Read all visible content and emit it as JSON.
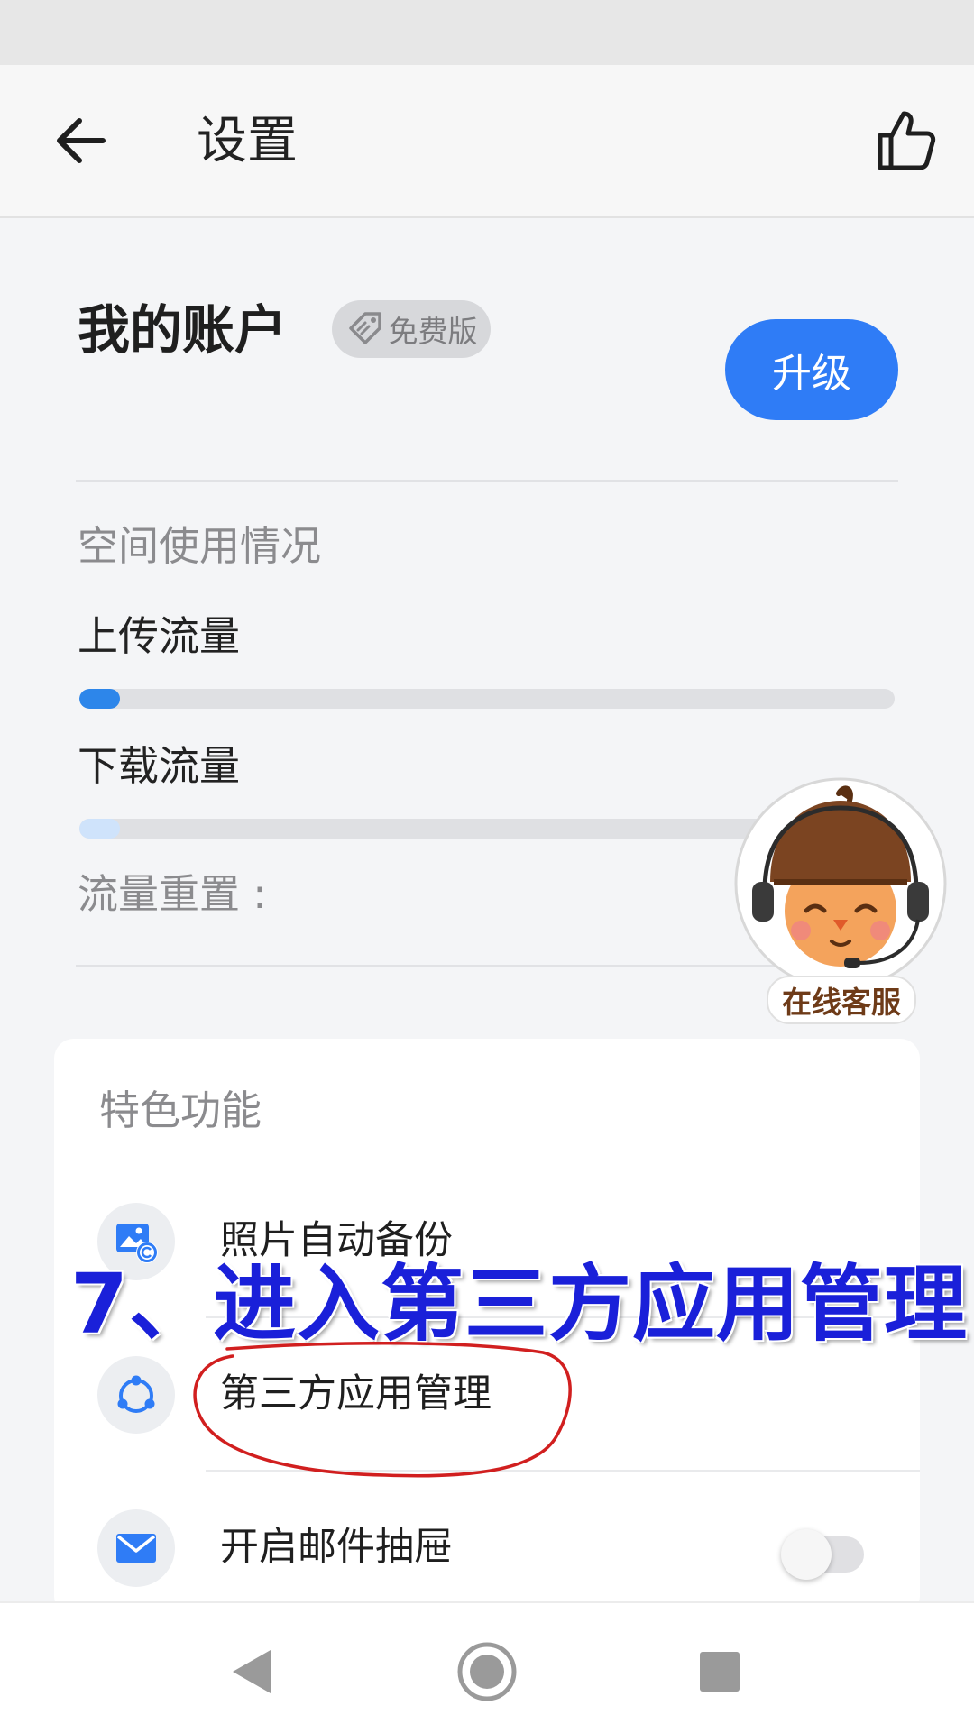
{
  "header": {
    "title": "设置",
    "back_icon": "back-arrow-icon",
    "like_icon": "thumbs-up-icon"
  },
  "account": {
    "title": "我的账户",
    "badge": "免费版",
    "badge_icon": "price-tag-icon",
    "upgrade_label": "升级"
  },
  "usage": {
    "section_title": "空间使用情况",
    "upload": {
      "label": "上传流量",
      "fraction": 0.05,
      "color": "#2d86ea"
    },
    "download": {
      "label": "下载流量",
      "fraction": 0.05,
      "color": "#cfe3fb"
    },
    "reset_label": "流量重置 :"
  },
  "features": {
    "title": "特色功能",
    "items": [
      {
        "label": "照片自动备份",
        "icon": "photo-backup-icon"
      },
      {
        "label": "第三方应用管理",
        "icon": "third-party-apps-icon"
      },
      {
        "label": "开启邮件抽屉",
        "icon": "mail-icon",
        "toggle": false
      }
    ]
  },
  "annotation": {
    "text": "7、进入第三方应用管理",
    "color": "#1a20d9",
    "circle_color": "#d11f1f"
  },
  "support": {
    "label": "在线客服",
    "icon": "customer-service-mascot-icon"
  },
  "nav": {
    "icons": [
      "nav-back-icon",
      "nav-home-icon",
      "nav-recents-icon"
    ]
  },
  "colors": {
    "accent": "#2f7cf6",
    "background": "#f4f5f7"
  }
}
